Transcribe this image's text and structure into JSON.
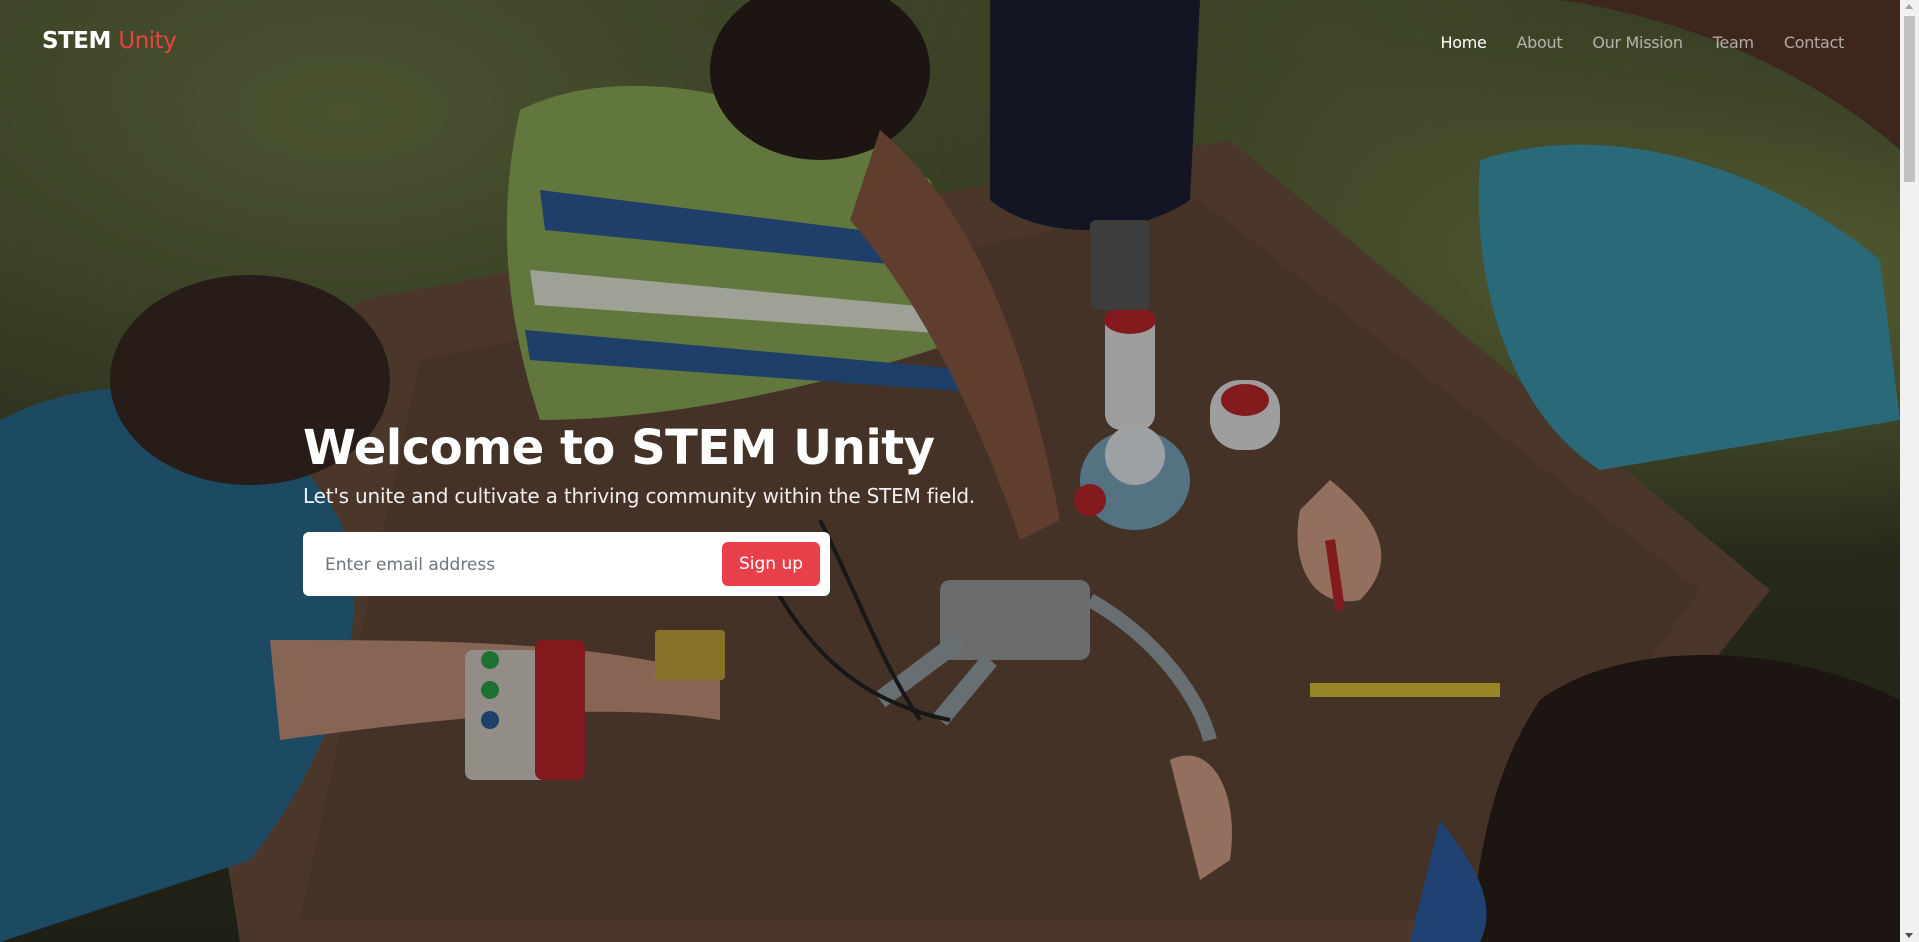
{
  "brand": {
    "first": "STEM",
    "second": "Unity"
  },
  "nav": {
    "items": [
      {
        "label": "Home"
      },
      {
        "label": "About"
      },
      {
        "label": "Our Mission"
      },
      {
        "label": "Team"
      },
      {
        "label": "Contact"
      }
    ],
    "active": "Home"
  },
  "hero": {
    "title": "Welcome to STEM Unity",
    "subtitle": "Let's unite and cultivate a thriving community within the STEM field.",
    "email_placeholder": "Enter email address",
    "signup_label": "Sign up"
  },
  "colors": {
    "accent": "#e8404a",
    "brand_accent": "#e8443f"
  }
}
